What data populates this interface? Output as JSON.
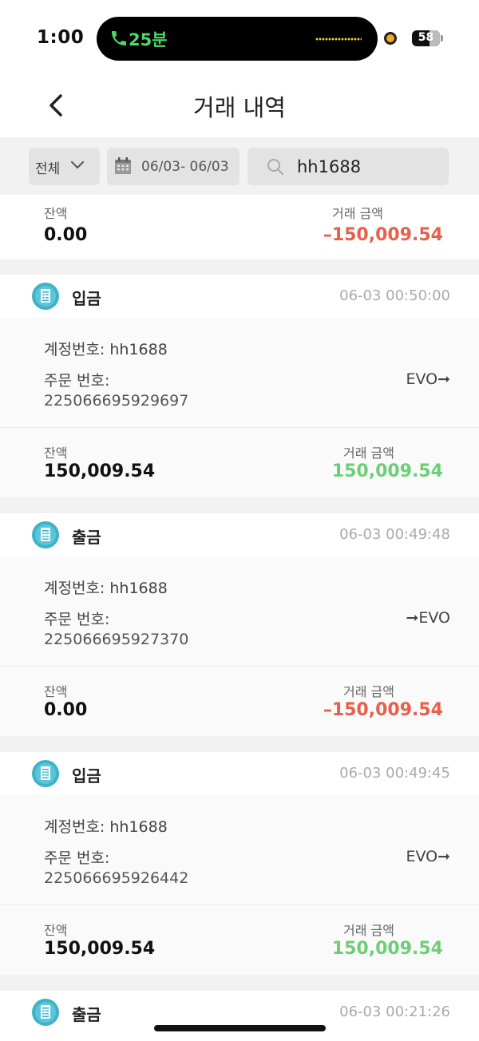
{
  "status_bar": {
    "time": "1:00",
    "call_duration": "25분",
    "battery": "58"
  },
  "header": {
    "title": "거래 내역"
  },
  "filters": {
    "type_value": "전체",
    "date_range": "06/03- 06/03",
    "search_value": "hh1688"
  },
  "summary": {
    "balance_label": "잔액",
    "balance": "0.00",
    "amount_label": "거래 금액",
    "amount": "–150,009.54"
  },
  "transactions": [
    {
      "type": "입금",
      "timestamp": "06-03 00:50:00",
      "account_line": "계정번호: hh1688",
      "order_label": "주문 번호:",
      "order_number": "225066695929697",
      "direction": "EVO➞",
      "balance_label": "잔액",
      "balance": "150,009.54",
      "amount_label": "거래 금액",
      "amount": "150,009.54"
    },
    {
      "type": "출금",
      "timestamp": "06-03 00:49:48",
      "account_line": "계정번호: hh1688",
      "order_label": "주문 번호:",
      "order_number": "225066695927370",
      "direction": "➞EVO",
      "balance_label": "잔액",
      "balance": "0.00",
      "amount_label": "거래 금액",
      "amount": "–150,009.54"
    },
    {
      "type": "입금",
      "timestamp": "06-03 00:49:45",
      "account_line": "계정번호: hh1688",
      "order_label": "주문 번호:",
      "order_number": "225066695926442",
      "direction": "EVO➞",
      "balance_label": "잔액",
      "balance": "150,009.54",
      "amount_label": "거래 금액",
      "amount": "150,009.54"
    },
    {
      "type": "출금",
      "timestamp": "06-03 00:21:26"
    }
  ],
  "colors": {
    "positive": "#6ccf76",
    "negative": "#e8604a",
    "icon": "#3fb2c8"
  }
}
